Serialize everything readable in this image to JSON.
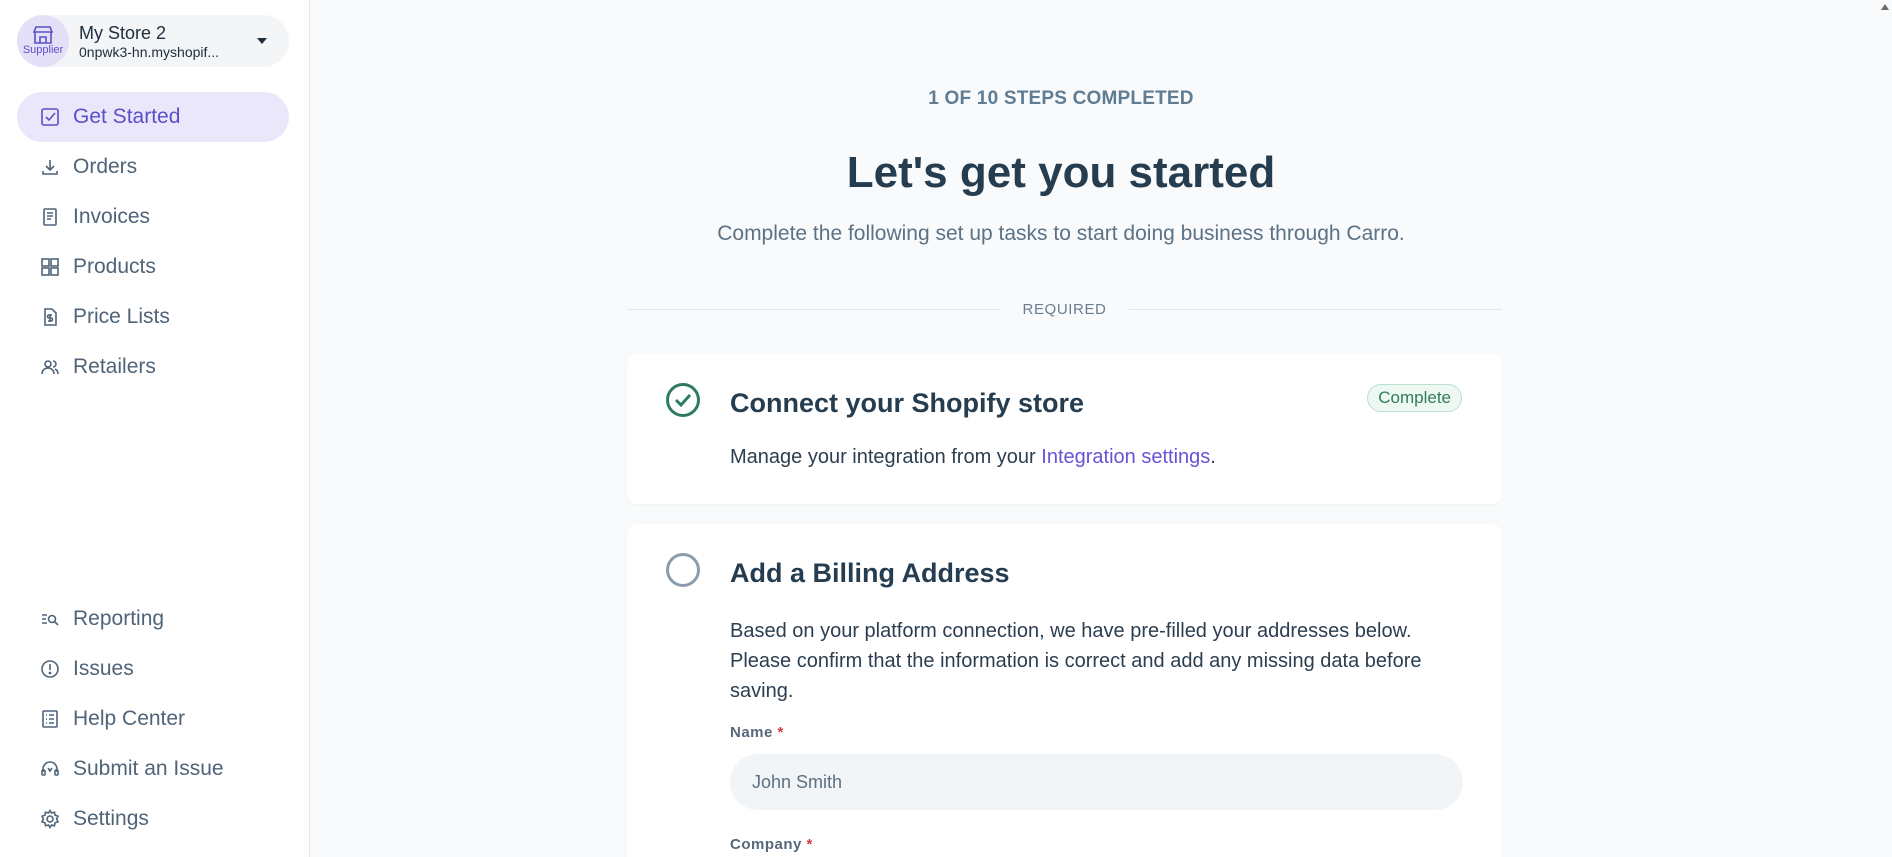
{
  "store": {
    "name": "My Store 2",
    "domain": "0npwk3-hn.myshopif...",
    "role": "Supplier"
  },
  "nav": {
    "top": [
      {
        "label": "Get Started",
        "icon": "checkbox-icon",
        "active": true
      },
      {
        "label": "Orders",
        "icon": "download-icon"
      },
      {
        "label": "Invoices",
        "icon": "receipt-icon"
      },
      {
        "label": "Products",
        "icon": "grid-icon"
      },
      {
        "label": "Price Lists",
        "icon": "dollar-document-icon"
      },
      {
        "label": "Retailers",
        "icon": "users-icon"
      }
    ],
    "bottom": [
      {
        "label": "Reporting",
        "icon": "report-search-icon"
      },
      {
        "label": "Issues",
        "icon": "alert-circle-icon"
      },
      {
        "label": "Help Center",
        "icon": "list-document-icon"
      },
      {
        "label": "Submit an Issue",
        "icon": "headset-icon"
      },
      {
        "label": "Settings",
        "icon": "gear-icon"
      }
    ]
  },
  "main": {
    "steps_label": "1 OF 10 STEPS COMPLETED",
    "title": "Let's get you started",
    "subtitle": "Complete the following set up tasks to start doing business through Carro.",
    "section_label": "REQUIRED",
    "tasks": [
      {
        "title": "Connect your Shopify store",
        "status": "Complete",
        "desc_prefix": "Manage your integration from your ",
        "desc_link": "Integration settings",
        "desc_suffix": "."
      },
      {
        "title": "Add a Billing Address",
        "desc": "Based on your platform connection, we have pre-filled your addresses below. Please confirm that the information is correct and add any missing data before saving.",
        "fields": {
          "name_label": "Name",
          "name_value": "John Smith",
          "company_label": "Company",
          "required_mark": "*"
        }
      }
    ]
  },
  "colors": {
    "accent": "#5b4fc7",
    "link": "#6753d6",
    "success": "#2f7b5e",
    "text": "#263d50"
  }
}
